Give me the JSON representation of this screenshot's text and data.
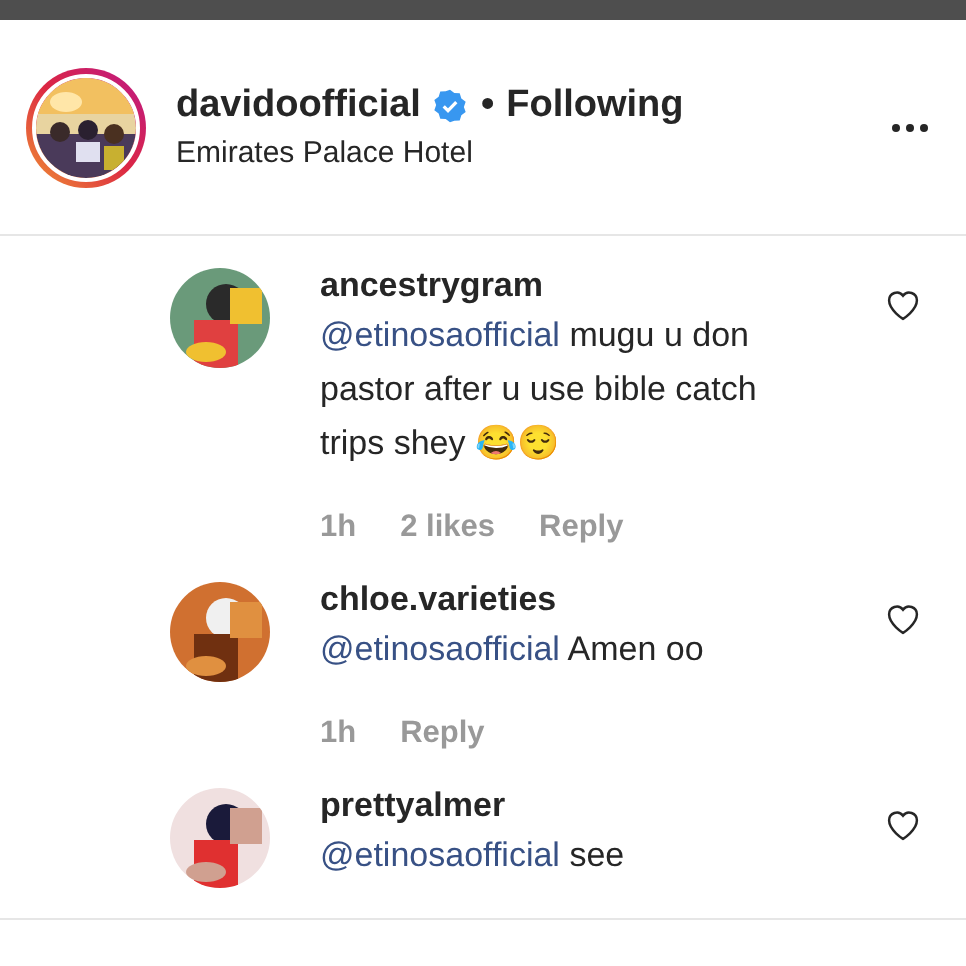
{
  "post_header": {
    "username": "davidoofficial",
    "verified": true,
    "separator": "•",
    "follow_status": "Following",
    "location": "Emirates Palace Hotel",
    "has_story": true
  },
  "comments": [
    {
      "username": "ancestrygram",
      "mention": "@etinosaofficial",
      "text": "mugu u don pastor after u use bible catch trips shey 😂😌",
      "time": "1h",
      "likes": "2 likes",
      "reply": "Reply",
      "liked": false
    },
    {
      "username": "chloe.varieties",
      "mention": "@etinosaofficial",
      "text": "Amen oo",
      "time": "1h",
      "reply": "Reply",
      "liked": false
    },
    {
      "username": "prettyalmer",
      "mention": "@etinosaofficial",
      "text": "see",
      "liked": false
    }
  ]
}
